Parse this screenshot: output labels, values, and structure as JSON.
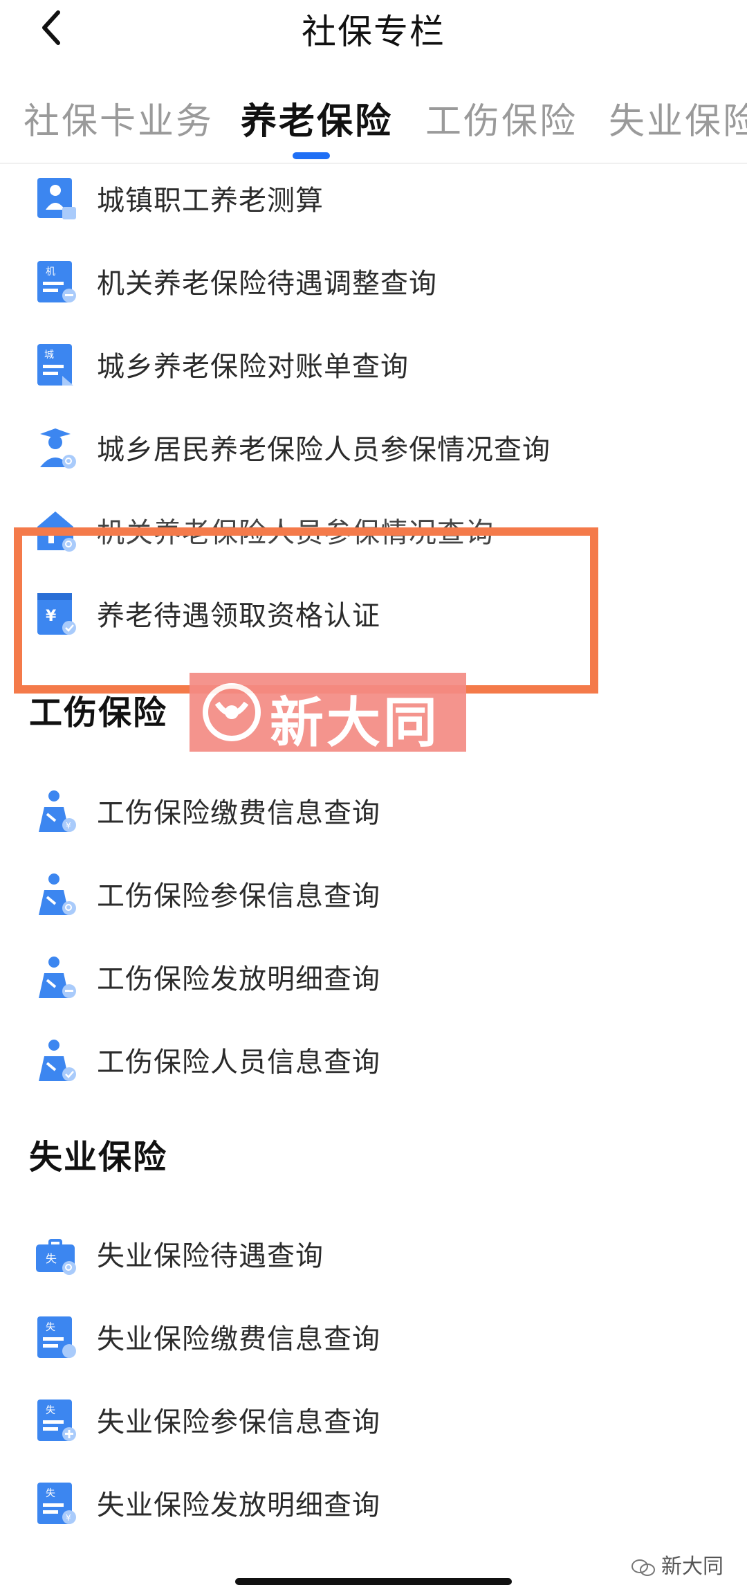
{
  "header": {
    "title": "社保专栏"
  },
  "tabs": [
    {
      "label": "社保卡业务",
      "active": false
    },
    {
      "label": "养老保险",
      "active": true
    },
    {
      "label": "工伤保险",
      "active": false
    },
    {
      "label": "失业保险",
      "active": false
    }
  ],
  "pension": {
    "items": [
      {
        "label": "城镇职工养老测算",
        "icon": "person-calc-icon"
      },
      {
        "label": "机关养老保险待遇调整查询",
        "icon": "document-ji-icon",
        "badge": "机"
      },
      {
        "label": "城乡养老保险对账单查询",
        "icon": "document-cheng-icon",
        "badge": "城"
      },
      {
        "label": "城乡居民养老保险人员参保情况查询",
        "icon": "person-search-icon"
      },
      {
        "label": "机关养老保险人员参保情况查询",
        "icon": "house-search-icon"
      },
      {
        "label": "养老待遇领取资格认证",
        "icon": "yuan-check-icon",
        "badge": "¥"
      }
    ]
  },
  "injury": {
    "title": "工伤保险",
    "items": [
      {
        "label": "工伤保险缴费信息查询",
        "icon": "person-yuan-icon"
      },
      {
        "label": "工伤保险参保信息查询",
        "icon": "person-search-icon"
      },
      {
        "label": "工伤保险发放明细查询",
        "icon": "person-minus-icon"
      },
      {
        "label": "工伤保险人员信息查询",
        "icon": "person-check-icon"
      }
    ]
  },
  "unemployment": {
    "title": "失业保险",
    "items": [
      {
        "label": "失业保险待遇查询",
        "icon": "briefcase-search-icon",
        "badge": "失"
      },
      {
        "label": "失业保险缴费信息查询",
        "icon": "doc-pay-icon",
        "badge": "失"
      },
      {
        "label": "失业保险参保信息查询",
        "icon": "doc-plus-icon",
        "badge": "失"
      },
      {
        "label": "失业保险发放明细查询",
        "icon": "doc-yuan-icon",
        "badge": "失"
      }
    ]
  },
  "watermark": {
    "text": "新大同",
    "corner_text": "新大同"
  },
  "colors": {
    "accent": "#1f6ff5",
    "icon_blue": "#3c86f0",
    "highlight": "#f47a4a",
    "stamp": "#f48b84"
  }
}
